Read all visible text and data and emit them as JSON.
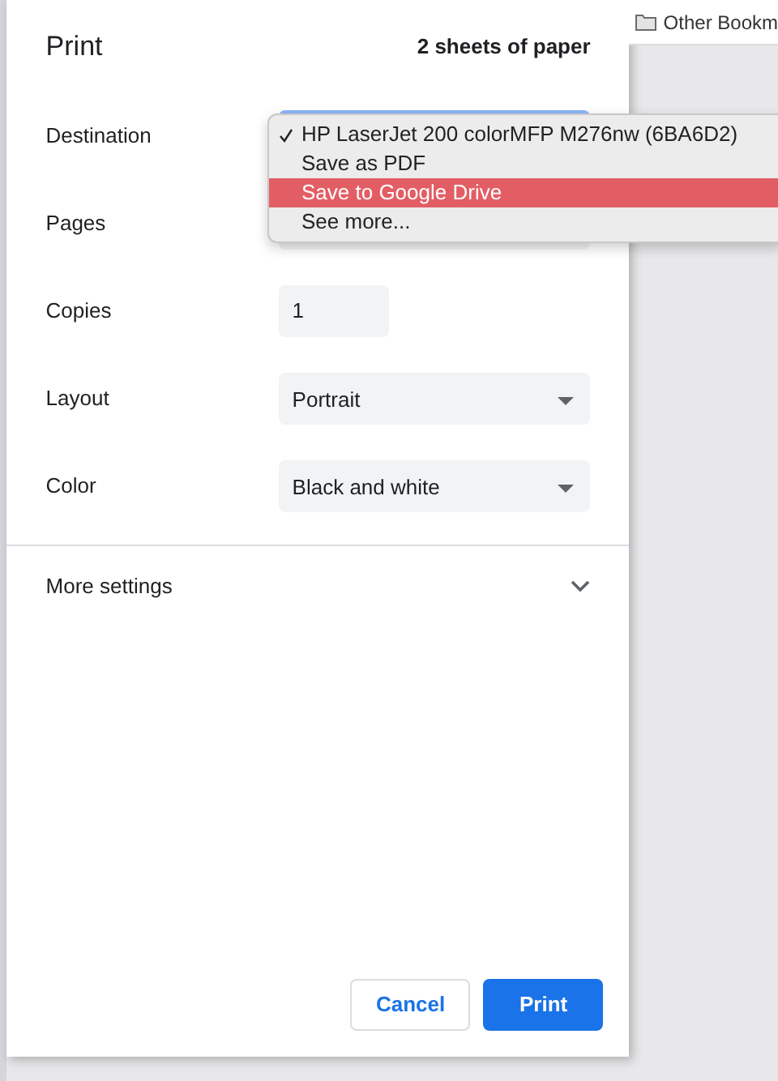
{
  "bookmarks_bar": {
    "label": "Other Bookm"
  },
  "dialog": {
    "title": "Print",
    "summary": "2 sheets of paper",
    "settings": [
      {
        "label": "Destination",
        "kind": "select",
        "focused": true
      },
      {
        "label": "Pages",
        "kind": "select"
      },
      {
        "label": "Copies",
        "kind": "input",
        "value": "1"
      },
      {
        "label": "Layout",
        "kind": "select",
        "value": "Portrait"
      },
      {
        "label": "Color",
        "kind": "select",
        "value": "Black and white"
      }
    ],
    "more_settings": {
      "label": "More settings",
      "expanded": false
    },
    "buttons": [
      {
        "label": "Cancel",
        "kind": "secondary"
      },
      {
        "label": "Print",
        "kind": "primary"
      }
    ]
  },
  "destination_menu": [
    {
      "label": "HP LaserJet 200 colorMFP M276nw (6BA6D2)",
      "checked": true,
      "selected": false
    },
    {
      "label": "Save as PDF",
      "checked": false,
      "selected": false
    },
    {
      "label": "Save to Google Drive",
      "checked": false,
      "selected": true
    },
    {
      "label": "See more...",
      "checked": false,
      "selected": false
    }
  ]
}
